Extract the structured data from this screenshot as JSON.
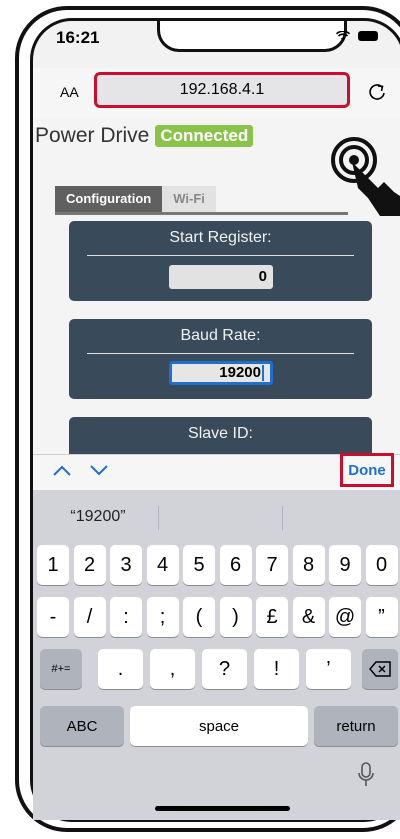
{
  "status": {
    "time": "16:21"
  },
  "browser": {
    "text_size_label": "AA",
    "url": "192.168.4.1"
  },
  "app": {
    "title": "Power Drive",
    "connection_status": "Connected"
  },
  "tabs": [
    {
      "label": "Configuration",
      "active": true
    },
    {
      "label": "Wi-Fi",
      "active": false
    }
  ],
  "fields": {
    "start_register": {
      "label": "Start Register:",
      "value": "0"
    },
    "baud_rate": {
      "label": "Baud Rate:",
      "value": "19200"
    },
    "slave_id": {
      "label": "Slave ID:"
    }
  },
  "accessory": {
    "done_label": "Done"
  },
  "keyboard": {
    "suggestion": "“19200”",
    "row1": [
      "1",
      "2",
      "3",
      "4",
      "5",
      "6",
      "7",
      "8",
      "9",
      "0"
    ],
    "row2": [
      "-",
      "/",
      ":",
      ";",
      "(",
      ")",
      "£",
      "&",
      "@",
      "”"
    ],
    "row3_left": "#+=",
    "row3": [
      ".",
      ",",
      "?",
      "!",
      "’"
    ],
    "abc_label": "ABC",
    "space_label": "space",
    "return_label": "return"
  },
  "colors": {
    "highlight": "#c8102e",
    "accent_blue": "#1e6fd0",
    "connected": "#8bc34a",
    "card": "#394a5a"
  }
}
